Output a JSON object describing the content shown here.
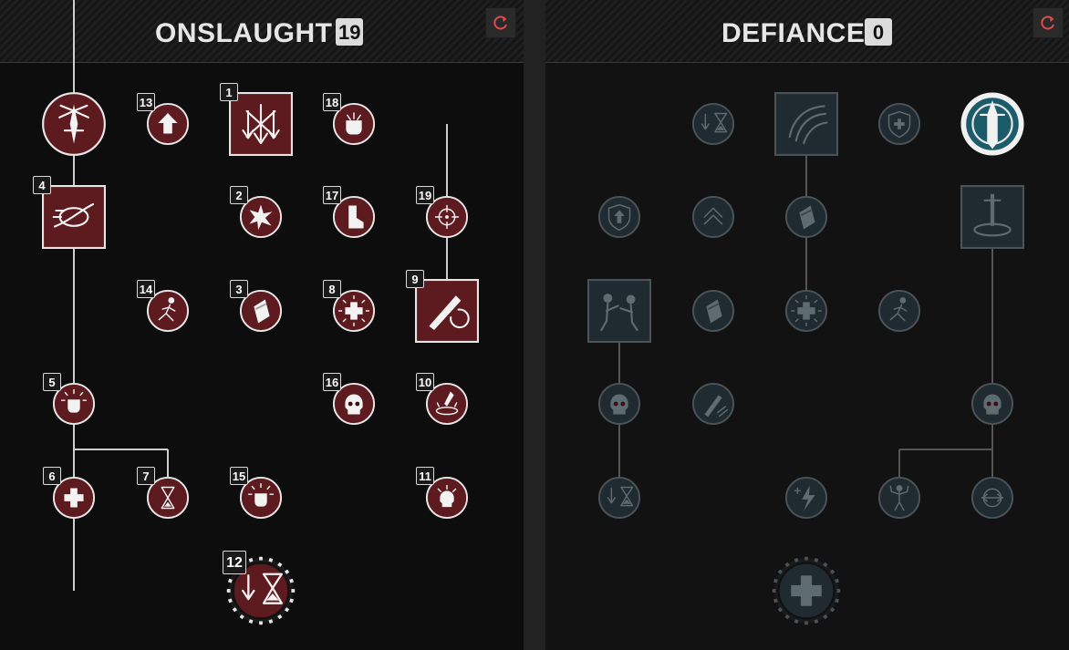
{
  "trees": [
    {
      "id": "onslaught",
      "title": "ONSLAUGHT",
      "points": "19",
      "theme": {
        "fill": "#5d1a1f",
        "ring": "#e6e6e6",
        "icon": "#f2f2f2",
        "line": "#cfcfcf"
      },
      "links": [
        [
          5,
          1,
          2
        ],
        [
          5,
          2,
          3
        ],
        [
          1,
          4,
          5
        ],
        [
          1,
          5,
          6
        ],
        [
          1,
          5,
          7
        ],
        [
          7,
          9,
          10
        ],
        [
          7,
          10,
          11
        ]
      ],
      "nodes": [
        {
          "id": "n0",
          "col": 1,
          "row": 1,
          "kind": "keystone",
          "glyph": "sword-star"
        },
        {
          "id": "n13",
          "col": 2,
          "row": 1,
          "kind": "small",
          "glyph": "arrow-up",
          "badge": "13"
        },
        {
          "id": "n1",
          "col": 3,
          "row": 1,
          "kind": "square",
          "glyph": "arrows-down",
          "badge": "1"
        },
        {
          "id": "n18",
          "col": 4,
          "row": 1,
          "kind": "small",
          "glyph": "fist",
          "badge": "18"
        },
        {
          "id": "n4",
          "col": 1,
          "row": 2,
          "kind": "square",
          "glyph": "swoosh",
          "badge": "4"
        },
        {
          "id": "n2",
          "col": 3,
          "row": 2,
          "kind": "small",
          "glyph": "burst",
          "badge": "2"
        },
        {
          "id": "n17",
          "col": 4,
          "row": 2,
          "kind": "small",
          "glyph": "boot",
          "badge": "17"
        },
        {
          "id": "n19",
          "col": 5,
          "row": 2,
          "kind": "small",
          "glyph": "crosshair",
          "badge": "19"
        },
        {
          "id": "n14",
          "col": 2,
          "row": 3,
          "kind": "small",
          "glyph": "runner",
          "badge": "14"
        },
        {
          "id": "n3",
          "col": 3,
          "row": 3,
          "kind": "small",
          "glyph": "shard",
          "badge": "3"
        },
        {
          "id": "n8",
          "col": 4,
          "row": 3,
          "kind": "small",
          "glyph": "cross-burst",
          "badge": "8"
        },
        {
          "id": "n9",
          "col": 5,
          "row": 3,
          "kind": "square",
          "glyph": "sword-fist",
          "badge": "9"
        },
        {
          "id": "n5",
          "col": 1,
          "row": 4,
          "kind": "small",
          "glyph": "fist-burst",
          "badge": "5"
        },
        {
          "id": "n16",
          "col": 4,
          "row": 4,
          "kind": "small",
          "glyph": "skull",
          "badge": "16"
        },
        {
          "id": "n10",
          "col": 5,
          "row": 4,
          "kind": "small",
          "glyph": "splash",
          "badge": "10"
        },
        {
          "id": "n6",
          "col": 1,
          "row": 5,
          "kind": "small",
          "glyph": "cross",
          "badge": "6"
        },
        {
          "id": "n7",
          "col": 2,
          "row": 5,
          "kind": "small",
          "glyph": "hourglass-swirl",
          "badge": "7"
        },
        {
          "id": "n15",
          "col": 3,
          "row": 5,
          "kind": "small",
          "glyph": "fist-burst",
          "badge": "15"
        },
        {
          "id": "n11",
          "col": 5,
          "row": 5,
          "kind": "small",
          "glyph": "skull-burst",
          "badge": "11"
        },
        {
          "id": "n12",
          "col": 3,
          "row": 6,
          "kind": "ultimate",
          "glyph": "hourglass-down",
          "badge": "12"
        }
      ]
    },
    {
      "id": "defiance",
      "title": "DEFIANCE",
      "points": "0",
      "theme": {
        "fill": "#1f2b30",
        "ring": "#4a5358",
        "icon": "#5e6b70",
        "line": "#555555"
      },
      "links": [
        [
          3,
          1,
          2
        ],
        [
          3,
          2,
          3
        ],
        [
          5,
          2,
          4
        ],
        [
          1,
          3,
          4
        ],
        [
          1,
          4,
          5
        ],
        [
          5,
          4,
          5
        ],
        [
          4,
          5,
          4
        ]
      ],
      "nodes": [
        {
          "id": "d1",
          "col": 2,
          "row": 1,
          "kind": "small",
          "glyph": "hourglass-down"
        },
        {
          "id": "d2",
          "col": 3,
          "row": 1,
          "kind": "square",
          "glyph": "claw"
        },
        {
          "id": "d3",
          "col": 4,
          "row": 1,
          "kind": "small",
          "glyph": "shield-cross"
        },
        {
          "id": "d4",
          "col": 5,
          "row": 1,
          "kind": "keystone-active",
          "glyph": "sword-shield"
        },
        {
          "id": "d5",
          "col": 1,
          "row": 2,
          "kind": "small",
          "glyph": "shield-up"
        },
        {
          "id": "d6",
          "col": 2,
          "row": 2,
          "kind": "small",
          "glyph": "chevrons-up"
        },
        {
          "id": "d7",
          "col": 3,
          "row": 2,
          "kind": "small",
          "glyph": "shard"
        },
        {
          "id": "d8",
          "col": 5,
          "row": 2,
          "kind": "square",
          "glyph": "sword-ground"
        },
        {
          "id": "d9",
          "col": 1,
          "row": 3,
          "kind": "square",
          "glyph": "brawl"
        },
        {
          "id": "d10",
          "col": 2,
          "row": 3,
          "kind": "small",
          "glyph": "shard"
        },
        {
          "id": "d11",
          "col": 3,
          "row": 3,
          "kind": "small",
          "glyph": "cross-burst"
        },
        {
          "id": "d12",
          "col": 4,
          "row": 3,
          "kind": "small",
          "glyph": "runner"
        },
        {
          "id": "d13",
          "col": 1,
          "row": 4,
          "kind": "small",
          "glyph": "skull"
        },
        {
          "id": "d14",
          "col": 2,
          "row": 4,
          "kind": "small",
          "glyph": "sword-slash"
        },
        {
          "id": "d15",
          "col": 5,
          "row": 4,
          "kind": "small",
          "glyph": "skull"
        },
        {
          "id": "d16",
          "col": 1,
          "row": 5,
          "kind": "small",
          "glyph": "hourglass-down"
        },
        {
          "id": "d17",
          "col": 3,
          "row": 5,
          "kind": "small",
          "glyph": "bolt-plus"
        },
        {
          "id": "d18",
          "col": 4,
          "row": 5,
          "kind": "small",
          "glyph": "flex"
        },
        {
          "id": "d19",
          "col": 5,
          "row": 5,
          "kind": "small",
          "glyph": "cycle"
        },
        {
          "id": "d20",
          "col": 3,
          "row": 6,
          "kind": "ultimate",
          "glyph": "cross"
        }
      ]
    }
  ]
}
